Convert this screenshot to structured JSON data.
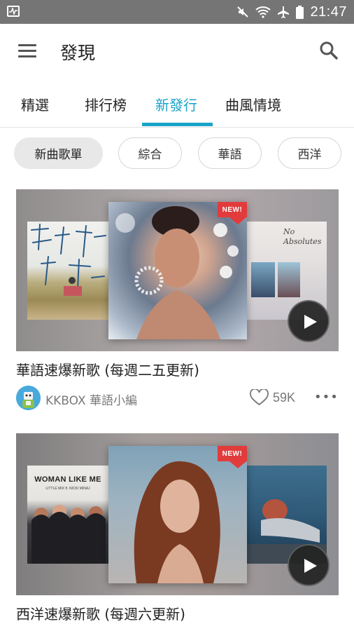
{
  "status_bar": {
    "time": "21:47",
    "icons": [
      "activity-icon",
      "mute-icon",
      "wifi-icon",
      "airplane-icon",
      "battery-icon"
    ]
  },
  "app_bar": {
    "title": "發現",
    "menu_icon": "hamburger-icon",
    "search_icon": "search-icon"
  },
  "tabs": [
    {
      "label": "精選",
      "active": false
    },
    {
      "label": "排行榜",
      "active": false
    },
    {
      "label": "新發行",
      "active": true
    },
    {
      "label": "曲風情境",
      "active": false
    }
  ],
  "filters": [
    {
      "label": "新曲歌單",
      "selected": true
    },
    {
      "label": "綜合",
      "selected": false
    },
    {
      "label": "華語",
      "selected": false
    },
    {
      "label": "西洋",
      "selected": false
    }
  ],
  "playlists": [
    {
      "title": "華語速爆新歌 (每週二五更新)",
      "author": "KKBOX 華語小編",
      "likes": "59K",
      "badge": "NEW!",
      "left_cover_text": "",
      "right_cover_text": "No Absolutes"
    },
    {
      "title": "西洋速爆新歌 (每週六更新)",
      "badge": "NEW!",
      "left_cover_text": "WOMAN LIKE ME",
      "left_cover_subtext": "LITTLE MIX ft. NICKI MINAJ"
    }
  ],
  "colors": {
    "accent": "#1aa3c9",
    "status_bar": "#757575",
    "badge": "#e23b3b"
  }
}
